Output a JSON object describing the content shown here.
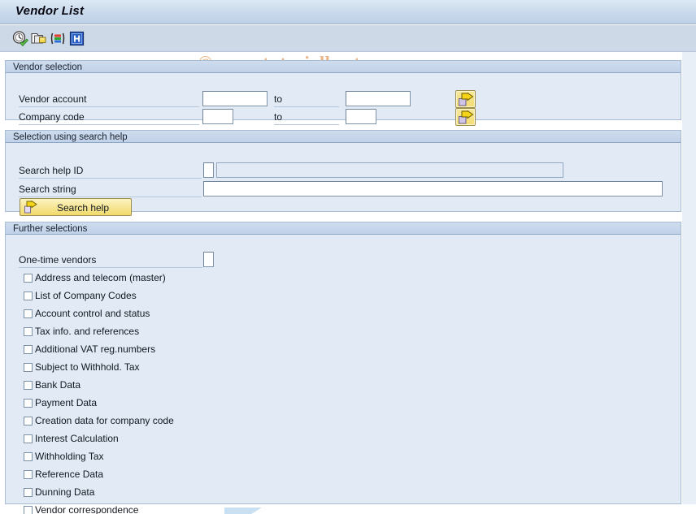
{
  "window": {
    "title": "Vendor List"
  },
  "toolbar": {
    "buttons": [
      {
        "name": "execute-icon",
        "tooltip": "Execute"
      },
      {
        "name": "execute-background-icon",
        "tooltip": "Execute in Background"
      },
      {
        "name": "variant-icon",
        "tooltip": "Get Variant"
      },
      {
        "name": "info-icon",
        "tooltip": "Information"
      }
    ]
  },
  "watermark": {
    "text": "© www.tutorialkart.com",
    "color": "#e8b88a"
  },
  "vendor_selection": {
    "header": "Vendor selection",
    "rows": [
      {
        "label": "Vendor account",
        "from_value": "",
        "from_placeholder": "",
        "to_label": "to",
        "to_value": "",
        "to_placeholder": "",
        "multi_select": "multiple-selection-icon"
      },
      {
        "label": "Company code",
        "from_value": "",
        "from_placeholder": "",
        "to_label": "to",
        "to_value": "",
        "to_placeholder": "",
        "multi_select": "multiple-selection-icon"
      }
    ]
  },
  "search_help_selection": {
    "header": "Selection using search help",
    "search_help_id": {
      "label": "Search help ID",
      "key_value": "",
      "description_value": ""
    },
    "search_string": {
      "label": "Search string",
      "value": ""
    },
    "button": {
      "label": "Search help",
      "icon": "arrow-right-icon"
    }
  },
  "further_selections": {
    "header": "Further selections",
    "one_time_vendors": {
      "label": "One-time vendors",
      "value": ""
    },
    "checkboxes": [
      {
        "label": "Address and telecom (master)",
        "checked": false
      },
      {
        "label": "List of Company Codes",
        "checked": false
      },
      {
        "label": "Account control and status",
        "checked": false
      },
      {
        "label": "Tax info. and references",
        "checked": false
      },
      {
        "label": "Additional VAT reg.numbers",
        "checked": false
      },
      {
        "label": "Subject to Withhold. Tax",
        "checked": false
      },
      {
        "label": "Bank Data",
        "checked": false
      },
      {
        "label": "Payment Data",
        "checked": false
      },
      {
        "label": "Creation data for company code",
        "checked": false
      },
      {
        "label": "Interest Calculation",
        "checked": false
      },
      {
        "label": "Withholding Tax",
        "checked": false
      },
      {
        "label": "Reference Data",
        "checked": false
      },
      {
        "label": "Dunning Data",
        "checked": false
      },
      {
        "label": "Vendor correspondence",
        "checked": false
      }
    ]
  },
  "theme": {
    "titlebar_color": "#c9d9ec",
    "toolbar_color": "#ced9e8",
    "panel_header_color": "#c1d1e8",
    "panel_body_color": "#e1eaf5",
    "button_yellow": "#f3dd74"
  }
}
